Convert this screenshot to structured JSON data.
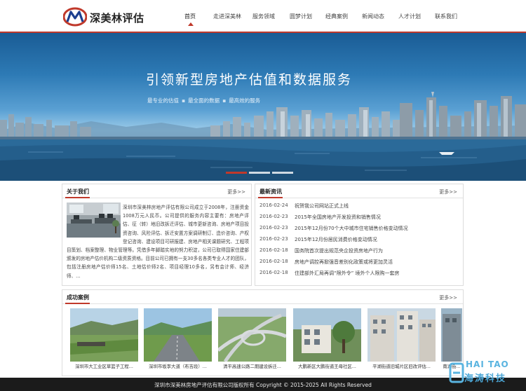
{
  "brand": {
    "name": "深美林评估",
    "color_primary": "#c0392b",
    "color_logo_blue": "#1d3f8f"
  },
  "nav": {
    "items": [
      "首页",
      "走进深美林",
      "服务领域",
      "圆梦计划",
      "经典案例",
      "新闻动态",
      "人才计划",
      "联系我们"
    ],
    "active_index": 0
  },
  "banner": {
    "title": "引领新型房地产估值和数据服务",
    "taglines": [
      "最专业的估值",
      "最全面的数据",
      "最高效的服务"
    ],
    "slides_count": 3,
    "active_slide": 0
  },
  "about": {
    "title": "关于我们",
    "more": "更多>>",
    "text": "深圳市深美林房地产评估有限公司成立于2008年，注册资金1008万元人民币。公司提供的服务内容主要有：房地产评估、征（转）地旧改拆迁评估、城市更新咨询、房地产项目投资咨询、风险评估、拆迁安置方案调研制订、造价咨询、产权登记咨询、建设项目可研报建、房地产相关课题研究、工程项目策划、档案整理、物业管理等。凭借多年脚踏实地的努力积淀，公司已取得国家住建部颁发的房地产估价机构二级资质资格。目前公司已拥有一支30多名各类专业人才的团队，包括注册房地产估价师15名、土地估价师2名、项目经理10多名，另有会计师、经济师、..."
  },
  "news": {
    "title": "最新资讯",
    "more": "更多>>",
    "items": [
      {
        "date": "2016-02-24",
        "title": "祝贺我公司网站正式上线"
      },
      {
        "date": "2016-02-23",
        "title": "2015年全国房地产开发投资和销售情况"
      },
      {
        "date": "2016-02-23",
        "title": "2015年12月份70个大中城市住宅销售价格变动情况"
      },
      {
        "date": "2016-02-23",
        "title": "2015年12月份居民消费价格变动情况"
      },
      {
        "date": "2016-02-18",
        "title": "国务院首次提出规范央企投资房地产行为"
      },
      {
        "date": "2016-02-18",
        "title": "房地产调控再掀强音差别化政策或将更加灵活"
      },
      {
        "date": "2016-02-18",
        "title": "住建部外汇局再调“限外令” 境外个人限购一套房"
      }
    ]
  },
  "cases": {
    "title": "成功案例",
    "more": "更多>>",
    "items": [
      {
        "caption": "深圳市大工业区草篮子工程..."
      },
      {
        "caption": "深圳市坂李大道（布吉段）..."
      },
      {
        "caption": "清平高速公路二期建设拆迁..."
      },
      {
        "caption": "大鹏新区大鹏街道王母社区..."
      },
      {
        "caption": "平湖街道旧城片区旧改评估..."
      },
      {
        "caption": "南湖街..."
      }
    ]
  },
  "footer": {
    "text": "深圳市深美林房地产评估有限公司版权所有 Copyright © 2015-2025 All Rights Reserved"
  },
  "watermark": {
    "line1": "HAI TAO",
    "line2": "海涛科技"
  }
}
